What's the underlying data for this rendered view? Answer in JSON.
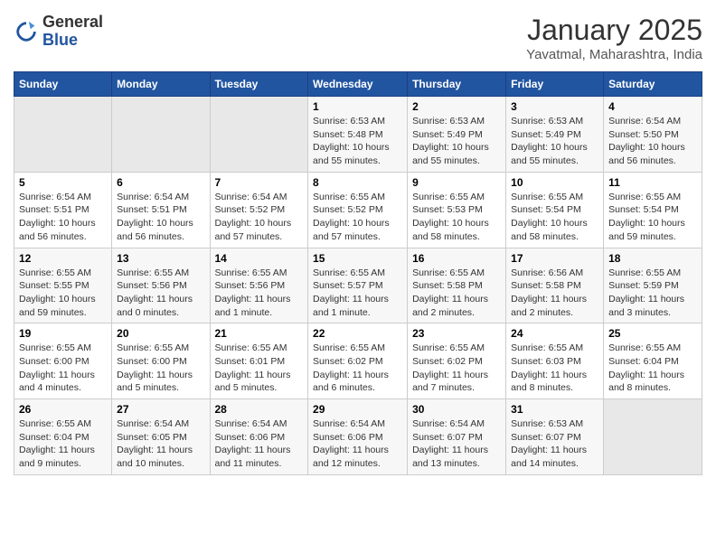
{
  "header": {
    "logo_general": "General",
    "logo_blue": "Blue",
    "month": "January 2025",
    "location": "Yavatmal, Maharashtra, India"
  },
  "days_of_week": [
    "Sunday",
    "Monday",
    "Tuesday",
    "Wednesday",
    "Thursday",
    "Friday",
    "Saturday"
  ],
  "weeks": [
    [
      {
        "day": "",
        "empty": true
      },
      {
        "day": "",
        "empty": true
      },
      {
        "day": "",
        "empty": true
      },
      {
        "day": "1",
        "sunrise": "6:53 AM",
        "sunset": "5:48 PM",
        "daylight": "10 hours and 55 minutes."
      },
      {
        "day": "2",
        "sunrise": "6:53 AM",
        "sunset": "5:49 PM",
        "daylight": "10 hours and 55 minutes."
      },
      {
        "day": "3",
        "sunrise": "6:53 AM",
        "sunset": "5:49 PM",
        "daylight": "10 hours and 55 minutes."
      },
      {
        "day": "4",
        "sunrise": "6:54 AM",
        "sunset": "5:50 PM",
        "daylight": "10 hours and 56 minutes."
      }
    ],
    [
      {
        "day": "5",
        "sunrise": "6:54 AM",
        "sunset": "5:51 PM",
        "daylight": "10 hours and 56 minutes."
      },
      {
        "day": "6",
        "sunrise": "6:54 AM",
        "sunset": "5:51 PM",
        "daylight": "10 hours and 56 minutes."
      },
      {
        "day": "7",
        "sunrise": "6:54 AM",
        "sunset": "5:52 PM",
        "daylight": "10 hours and 57 minutes."
      },
      {
        "day": "8",
        "sunrise": "6:55 AM",
        "sunset": "5:52 PM",
        "daylight": "10 hours and 57 minutes."
      },
      {
        "day": "9",
        "sunrise": "6:55 AM",
        "sunset": "5:53 PM",
        "daylight": "10 hours and 58 minutes."
      },
      {
        "day": "10",
        "sunrise": "6:55 AM",
        "sunset": "5:54 PM",
        "daylight": "10 hours and 58 minutes."
      },
      {
        "day": "11",
        "sunrise": "6:55 AM",
        "sunset": "5:54 PM",
        "daylight": "10 hours and 59 minutes."
      }
    ],
    [
      {
        "day": "12",
        "sunrise": "6:55 AM",
        "sunset": "5:55 PM",
        "daylight": "10 hours and 59 minutes."
      },
      {
        "day": "13",
        "sunrise": "6:55 AM",
        "sunset": "5:56 PM",
        "daylight": "11 hours and 0 minutes."
      },
      {
        "day": "14",
        "sunrise": "6:55 AM",
        "sunset": "5:56 PM",
        "daylight": "11 hours and 1 minute."
      },
      {
        "day": "15",
        "sunrise": "6:55 AM",
        "sunset": "5:57 PM",
        "daylight": "11 hours and 1 minute."
      },
      {
        "day": "16",
        "sunrise": "6:55 AM",
        "sunset": "5:58 PM",
        "daylight": "11 hours and 2 minutes."
      },
      {
        "day": "17",
        "sunrise": "6:56 AM",
        "sunset": "5:58 PM",
        "daylight": "11 hours and 2 minutes."
      },
      {
        "day": "18",
        "sunrise": "6:55 AM",
        "sunset": "5:59 PM",
        "daylight": "11 hours and 3 minutes."
      }
    ],
    [
      {
        "day": "19",
        "sunrise": "6:55 AM",
        "sunset": "6:00 PM",
        "daylight": "11 hours and 4 minutes."
      },
      {
        "day": "20",
        "sunrise": "6:55 AM",
        "sunset": "6:00 PM",
        "daylight": "11 hours and 5 minutes."
      },
      {
        "day": "21",
        "sunrise": "6:55 AM",
        "sunset": "6:01 PM",
        "daylight": "11 hours and 5 minutes."
      },
      {
        "day": "22",
        "sunrise": "6:55 AM",
        "sunset": "6:02 PM",
        "daylight": "11 hours and 6 minutes."
      },
      {
        "day": "23",
        "sunrise": "6:55 AM",
        "sunset": "6:02 PM",
        "daylight": "11 hours and 7 minutes."
      },
      {
        "day": "24",
        "sunrise": "6:55 AM",
        "sunset": "6:03 PM",
        "daylight": "11 hours and 8 minutes."
      },
      {
        "day": "25",
        "sunrise": "6:55 AM",
        "sunset": "6:04 PM",
        "daylight": "11 hours and 8 minutes."
      }
    ],
    [
      {
        "day": "26",
        "sunrise": "6:55 AM",
        "sunset": "6:04 PM",
        "daylight": "11 hours and 9 minutes."
      },
      {
        "day": "27",
        "sunrise": "6:54 AM",
        "sunset": "6:05 PM",
        "daylight": "11 hours and 10 minutes."
      },
      {
        "day": "28",
        "sunrise": "6:54 AM",
        "sunset": "6:06 PM",
        "daylight": "11 hours and 11 minutes."
      },
      {
        "day": "29",
        "sunrise": "6:54 AM",
        "sunset": "6:06 PM",
        "daylight": "11 hours and 12 minutes."
      },
      {
        "day": "30",
        "sunrise": "6:54 AM",
        "sunset": "6:07 PM",
        "daylight": "11 hours and 13 minutes."
      },
      {
        "day": "31",
        "sunrise": "6:53 AM",
        "sunset": "6:07 PM",
        "daylight": "11 hours and 14 minutes."
      },
      {
        "day": "",
        "empty": true
      }
    ]
  ],
  "labels": {
    "sunrise": "Sunrise:",
    "sunset": "Sunset:",
    "daylight": "Daylight:"
  }
}
